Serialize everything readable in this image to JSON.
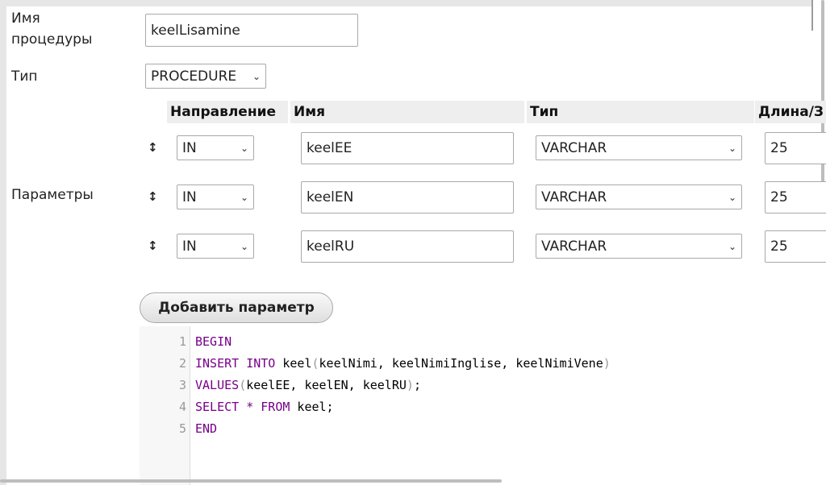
{
  "form": {
    "name_label_line1": "Имя",
    "name_label_line2": "процедуры",
    "name_value": "keelLisamine",
    "type_label": "Тип",
    "type_value": "PROCEDURE",
    "params_label": "Параметры",
    "add_param_label": "Добавить параметр"
  },
  "params_table": {
    "headers": [
      "Направление",
      "Имя",
      "Тип",
      "Длина/З"
    ],
    "rows": [
      {
        "direction": "IN",
        "name": "keelEE",
        "type": "VARCHAR",
        "length": "25"
      },
      {
        "direction": "IN",
        "name": "keelEN",
        "type": "VARCHAR",
        "length": "25"
      },
      {
        "direction": "IN",
        "name": "keelRU",
        "type": "VARCHAR",
        "length": "25"
      }
    ]
  },
  "icons": {
    "move_handle": "↕-icon",
    "dropdown": "chevron-down-icon"
  },
  "editor": {
    "line_numbers": [
      "1",
      "2",
      "3",
      "4",
      "5"
    ],
    "line1": {
      "kw": "BEGIN"
    },
    "line2": {
      "kw": "INSERT INTO",
      "rest": " keel",
      "open": "(",
      "args": "keelNimi, keelNimiInglise, keelNimiVene",
      "close": ")"
    },
    "line3": {
      "kw": "VALUES",
      "open": "(",
      "args": "keelEE, keelEN, keelRU",
      "close": ")",
      "end": ";"
    },
    "line4": {
      "kw1": "SELECT",
      "star": " * ",
      "kw2": "FROM",
      "rest": " keel;"
    },
    "line5": {
      "kw": "END"
    },
    "colors": {
      "keyword": "#770088",
      "bracket": "#999999",
      "text": "#000000"
    }
  }
}
